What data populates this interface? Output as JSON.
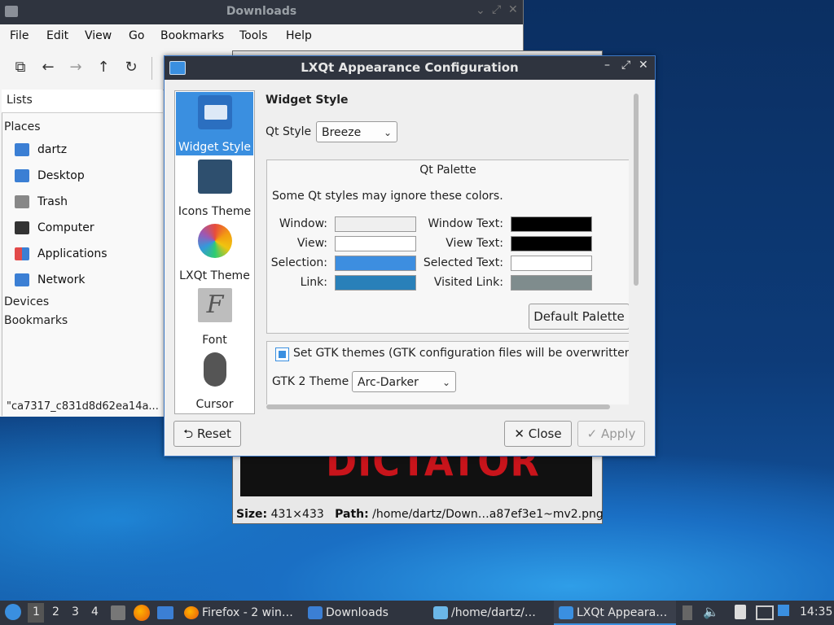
{
  "file_manager": {
    "title": "Downloads",
    "menu": [
      "File",
      "Edit",
      "View",
      "Go",
      "Bookmarks",
      "Tools",
      "Help"
    ],
    "view_mode": "Lists",
    "places_header": "Places",
    "places": [
      {
        "label": "dartz",
        "icon": "home-folder-icon",
        "color": "#3b7fd4"
      },
      {
        "label": "Desktop",
        "icon": "desktop-icon",
        "color": "#3b7fd4"
      },
      {
        "label": "Trash",
        "icon": "trash-icon",
        "color": "#888888"
      },
      {
        "label": "Computer",
        "icon": "computer-icon",
        "color": "#333333"
      },
      {
        "label": "Applications",
        "icon": "applications-icon",
        "color": "#e24a4a"
      },
      {
        "label": "Network",
        "icon": "network-icon",
        "color": "#3b7fd4"
      }
    ],
    "devices_header": "Devices",
    "bookmarks_header": "Bookmarks",
    "status_text": "\"ca7317_c831d8d62ea14a..."
  },
  "image_viewer": {
    "image_text": "DICTATOR",
    "size_label": "Size:",
    "size_value": "431×433",
    "path_label": "Path:",
    "path_value": "/home/dartz/Down…a87ef3e1~mv2.png"
  },
  "dialog": {
    "title": "LXQt Appearance Configuration",
    "categories": [
      {
        "label": "Widget Style",
        "icon": "widget-style-icon",
        "selected": true
      },
      {
        "label": "Icons Theme",
        "icon": "icons-theme-icon",
        "selected": false
      },
      {
        "label": "LXQt Theme",
        "icon": "lxqt-theme-icon",
        "selected": false
      },
      {
        "label": "Font",
        "icon": "font-icon",
        "selected": false
      },
      {
        "label": "Cursor",
        "icon": "cursor-icon",
        "selected": false
      }
    ],
    "section_title": "Widget Style",
    "qt_style_label": "Qt Style",
    "qt_style_value": "Breeze",
    "palette": {
      "title": "Qt Palette",
      "note": "Some Qt styles may ignore these colors.",
      "window_label": "Window:",
      "window_color": "#efefef",
      "view_label": "View:",
      "view_color": "#ffffff",
      "selection_label": "Selection:",
      "selection_color": "#3d8ee0",
      "link_label": "Link:",
      "link_color": "#2980b9",
      "window_text_label": "Window Text:",
      "window_text_color": "#000000",
      "view_text_label": "View Text:",
      "view_text_color": "#000000",
      "selected_text_label": "Selected Text:",
      "selected_text_color": "#ffffff",
      "visited_link_label": "Visited Link:",
      "visited_link_color": "#7f8c8d",
      "default_button": "Default Palette"
    },
    "gtk_checkbox_label": "Set GTK themes (GTK configuration files will be overwritten!)",
    "gtk_checked": true,
    "gtk2_label": "GTK 2 Theme",
    "gtk2_value": "Arc-Darker",
    "reset_button": "Reset",
    "close_button": "Close",
    "apply_button": "Apply"
  },
  "taskbar": {
    "desktops": [
      "1",
      "2",
      "3",
      "4"
    ],
    "tasks": [
      {
        "label": "Firefox - 2 win…",
        "icon": "firefox-icon"
      },
      {
        "label": "Downloads",
        "icon": "folder-icon"
      },
      {
        "label": "/home/dartz/…",
        "icon": "image-viewer-icon"
      },
      {
        "label": "LXQt Appeara…",
        "icon": "settings-icon"
      }
    ],
    "clock": "14:35"
  }
}
